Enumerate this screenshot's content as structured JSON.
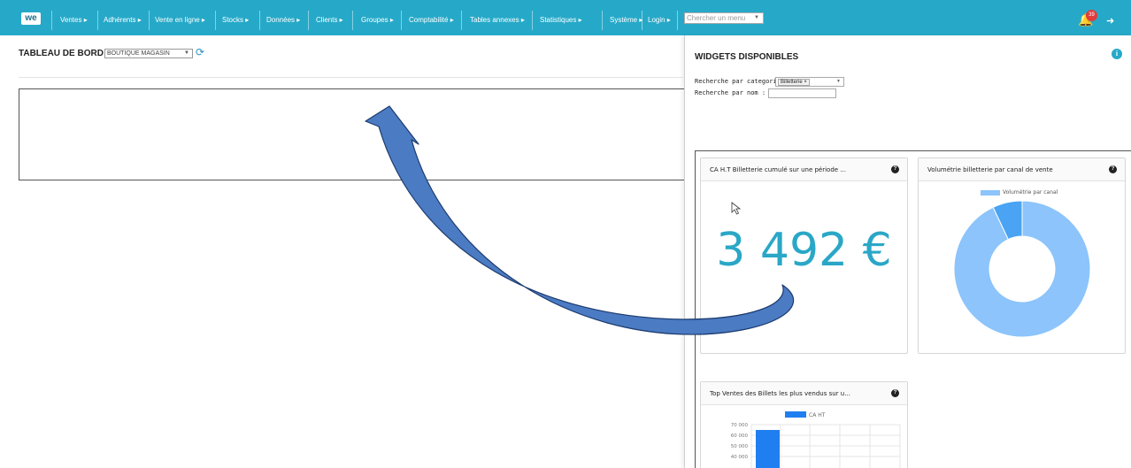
{
  "topnav": {
    "logo": "we",
    "menu": [
      "Ventes ▸",
      "Adhérents ▸",
      "Vente en ligne ▸",
      "Stocks ▸",
      "Données ▸",
      "Clients ▸",
      "Groupes ▸",
      "Comptabilité ▸",
      "Tables annexes ▸",
      "Statistiques ▸",
      "Système ▸",
      "Login ▸"
    ],
    "search_placeholder": "Chercher un menu",
    "notification_count": "39"
  },
  "dashboard": {
    "title": "TABLEAU DE BORD",
    "store_selected": "BOUTIQUE MAGASIN"
  },
  "panel": {
    "title": "WIDGETS DISPONIBLES",
    "filter_category_label": "Recherche par categorie :",
    "filter_category_value": "Billetterie ×",
    "filter_name_label": "Recherche par nom :"
  },
  "widgets": {
    "revenue": {
      "title": "CA H.T Billetterie cumulé sur une période ...",
      "value": "3 492 €"
    },
    "volume": {
      "title": "Volumétrie billetterie par canal de vente",
      "legend": "Volumétrie par canal",
      "chart_data": {
        "type": "pie",
        "donut": true,
        "slices": [
          {
            "label": "",
            "value": 93,
            "color": "#8cc4fb"
          },
          {
            "label": "",
            "value": 7,
            "color": "#4aa3f3"
          }
        ]
      }
    },
    "top_sales": {
      "title": "Top Ventes des Billets les plus vendus sur u...",
      "legend": "CA HT",
      "chart_data": {
        "type": "bar",
        "series": [
          {
            "name": "CA HT",
            "values": [
              65000
            ]
          }
        ],
        "yticks": [
          "70 000",
          "60 000",
          "50 000",
          "40 000"
        ],
        "ylim": [
          40000,
          70000
        ]
      }
    }
  },
  "colors": {
    "nav_bg": "#26a9c8",
    "accent": "#2aa7c7",
    "arrow": "#4a7cc0",
    "bar": "#1f7ff0"
  }
}
